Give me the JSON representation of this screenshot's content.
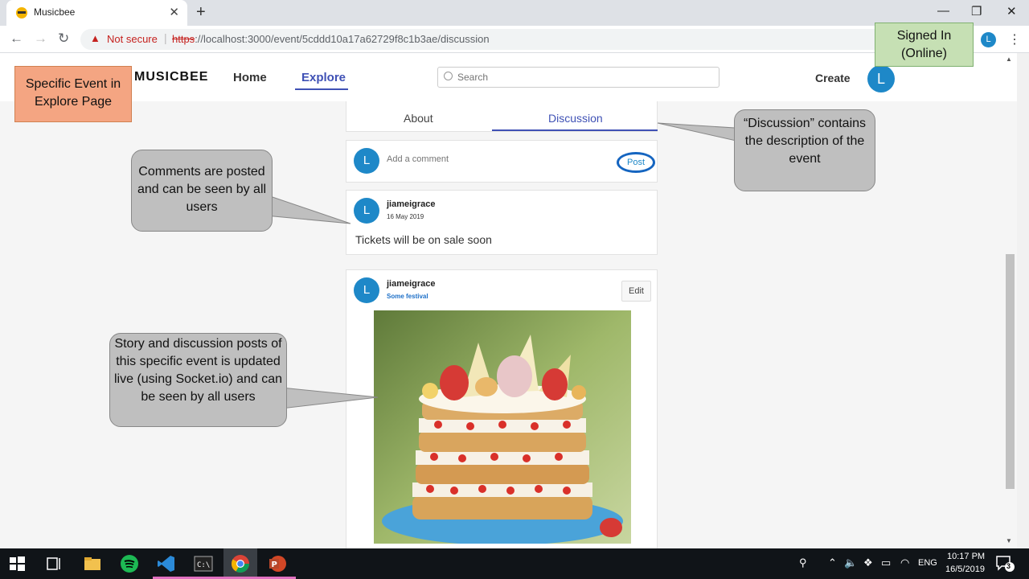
{
  "browser": {
    "tab_title": "Musicbee",
    "tab_close": "✕",
    "new_tab": "+",
    "minimize": "—",
    "restore": "❐",
    "close": "✕",
    "security_label": "Not secure",
    "url_scheme": "https",
    "url_rest": "://localhost:3000/event/5cddd10a17a62729f8c1b3ae/discussion",
    "profile_initial": "L"
  },
  "header": {
    "logo": "MUSICBEE",
    "nav": {
      "home": "Home",
      "explore": "Explore"
    },
    "search_placeholder": "Search",
    "create_label": "Create",
    "avatar_initial": "L"
  },
  "event_tabs": {
    "about": "About",
    "discussion": "Discussion",
    "active": "Discussion"
  },
  "comment_box": {
    "avatar_initial": "L",
    "placeholder": "Add a comment",
    "post_label": "Post"
  },
  "comments": [
    {
      "avatar_initial": "L",
      "username": "jiameigrace",
      "date": "16 May 2019",
      "text": "Tickets will be on sale soon"
    }
  ],
  "story": {
    "avatar_initial": "L",
    "username": "jiameigrace",
    "event_link": "Some festival",
    "edit_label": "Edit"
  },
  "annotations": {
    "explore_page": "Specific Event in Explore Page",
    "signed_in": "Signed In (Online)",
    "discussion": "“Discussion” contains the description of the event",
    "comments": "Comments are posted and can be seen by all users",
    "story": "Story and discussion posts of this specific event is updated live (using Socket.io) and can be seen by all users"
  },
  "taskbar": {
    "language": "ENG",
    "time": "10:17 PM",
    "date": "16/5/2019",
    "notification_count": "3"
  },
  "colors": {
    "accent": "#3f51b5",
    "avatar": "#1e88c8",
    "annotation_orange": "#f4a582",
    "annotation_green": "#c6e0b4",
    "bubble_gray": "#bfbfbf"
  }
}
